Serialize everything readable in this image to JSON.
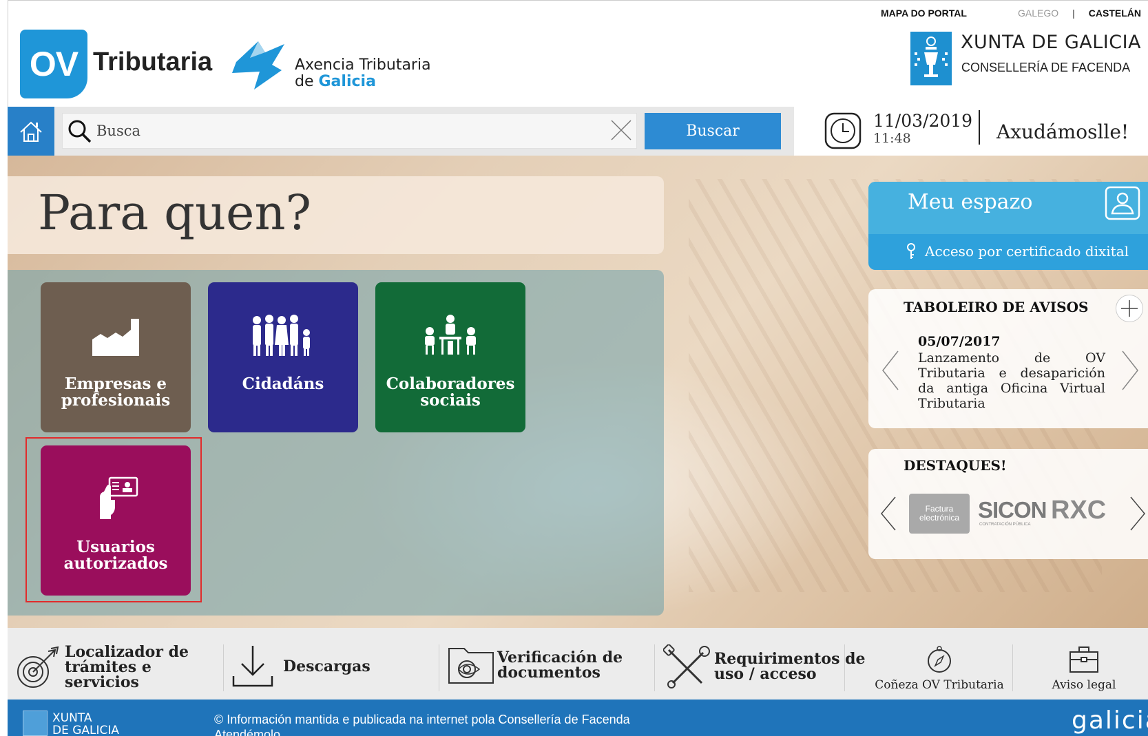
{
  "header": {
    "top_nav": {
      "map": "MAPA DO PORTAL",
      "galego": "GALEGO",
      "separator": "|",
      "castelan": "CASTELÁN"
    },
    "ov_badge": "OV",
    "brand_word": "Tributaria",
    "agency_line1": "Axencia Tributaria",
    "agency_line2_prefix": "de",
    "agency_line2_highlight": "Galicia",
    "xunta_title": "XUNTA DE GALICIA",
    "xunta_subtitle": "CONSELLERÍA DE FACENDA"
  },
  "search": {
    "placeholder": "Busca",
    "button_label": "Buscar"
  },
  "datetime": {
    "date": "11/03/2019",
    "time": "11:48"
  },
  "help_label": "Axudámoslle!",
  "main": {
    "title": "Para quen?",
    "tiles": [
      {
        "label_1": "Empresas e",
        "label_2": "profesionais",
        "icon": "factory-icon",
        "color": "#6e5e50"
      },
      {
        "label_1": "Cidadáns",
        "icon": "people-icon",
        "color": "#2c2a8c"
      },
      {
        "label_1": "Colaboradores",
        "label_2": "sociais",
        "icon": "meeting-icon",
        "color": "#126b38"
      },
      {
        "label_1": "Usuarios",
        "label_2": "autorizados",
        "icon": "hand-card-icon",
        "color": "#9a0e5c"
      }
    ],
    "highlight_color": "#e12b2b"
  },
  "right": {
    "meu_espazo": "Meu espazo",
    "cert_link": "Acceso por certificado dixital",
    "avisos_title": "TABOLEIRO DE AVISOS",
    "aviso": {
      "date": "05/07/2017",
      "text": "Lanzamento de OV Tributaria e desaparición da antiga Oficina Virtual Tributaria"
    },
    "destaques_title": "DESTAQUES!",
    "destaques": {
      "factura_1": "Factura",
      "factura_2": "electrónica",
      "sicon": "SICON",
      "sicon_sub": "CONTRATACIÓN PÚBLICA",
      "rxc": "RXC"
    }
  },
  "bottom": {
    "localizador_1": "Localizador de",
    "localizador_2": "trámites e",
    "localizador_3": "servicios",
    "descargas": "Descargas",
    "verificacion_1": "Verificación de",
    "verificacion_2": "documentos",
    "requirimentos_1": "Requirimentos de",
    "requirimentos_2": "uso / acceso",
    "coneza": "Coñeza OV Tributaria",
    "aviso_legal": "Aviso legal"
  },
  "footer": {
    "xunta_1": "XUNTA",
    "xunta_2": "DE GALICIA",
    "info_1": "© Información mantida e publicada na internet pola Consellería de Facenda",
    "info_2": "Atendémolo",
    "galicia_logo": "galicia"
  },
  "colors": {
    "accent_blue": "#2d8bd3",
    "header_blue": "#1f96d8",
    "footer_blue": "#1f74ba"
  }
}
